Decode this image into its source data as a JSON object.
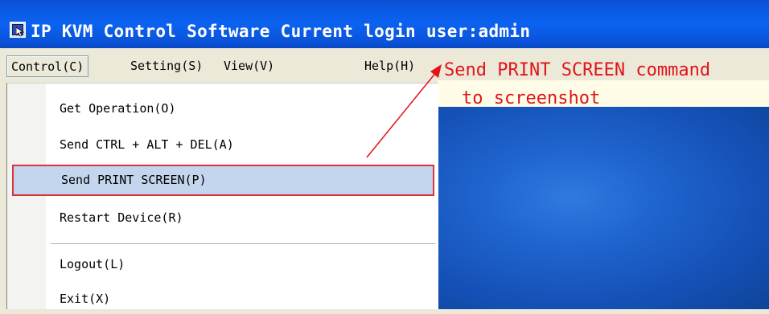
{
  "window": {
    "title": "IP KVM Control Software Current login user:admin"
  },
  "menubar": {
    "items": [
      {
        "id": "control",
        "label": "Control(C)"
      },
      {
        "id": "setting",
        "label": "Setting(S)"
      },
      {
        "id": "view",
        "label": "View(V)"
      },
      {
        "id": "help",
        "label": "Help(H)"
      }
    ]
  },
  "control_menu": {
    "items": [
      {
        "label": "Get Operation(O)"
      },
      {
        "label": "Send CTRL + ALT + DEL(A)"
      },
      {
        "label": "Send PRINT SCREEN(P)",
        "highlighted": true
      },
      {
        "label": "Restart Device(R)"
      },
      {
        "label": "Logout(L)"
      },
      {
        "label": "Exit(X)"
      }
    ]
  },
  "annotation": {
    "line1": "Send PRINT SCREEN command",
    "line2": "to screenshot"
  },
  "colors": {
    "titlebar": "#0b5ae4",
    "annotation": "#e0141a",
    "highlight": "#c4d6ee",
    "highlight_border": "#d9343c",
    "desktop": "#1e62cc"
  },
  "icons": {
    "app_icon": "window-cursor-icon"
  }
}
